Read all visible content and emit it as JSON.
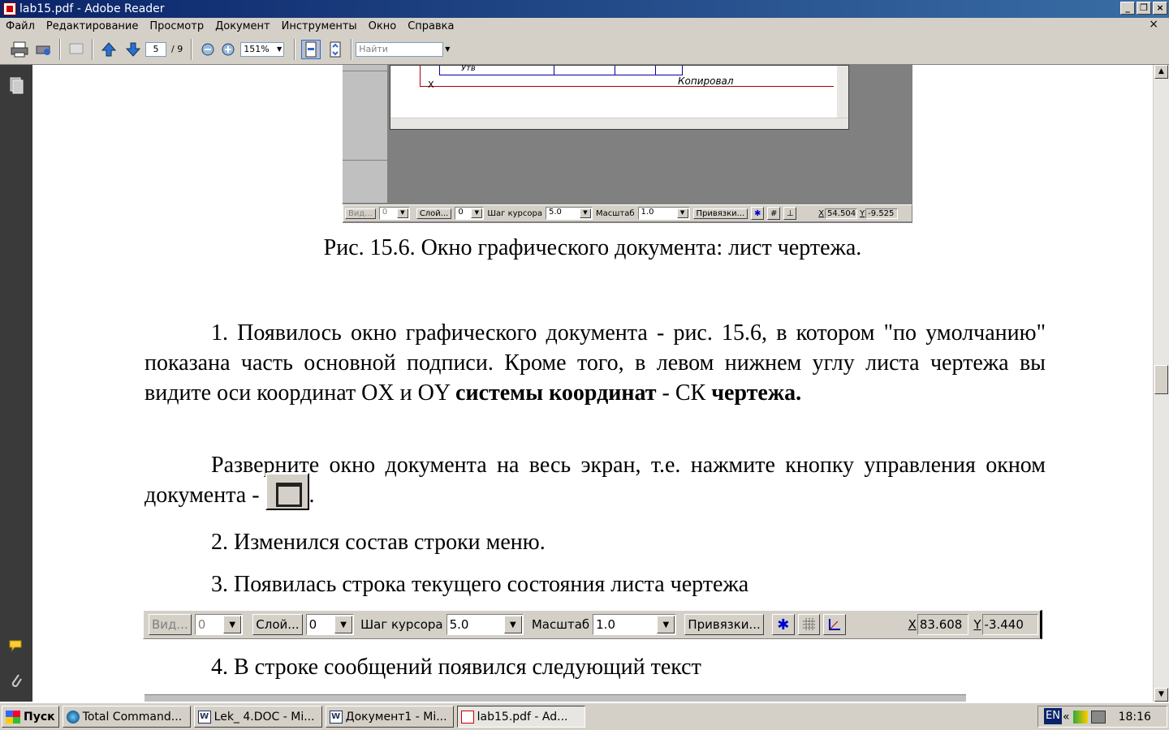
{
  "window": {
    "title": "lab15.pdf - Adobe Reader",
    "btn_min": "_",
    "btn_restore": "❐",
    "btn_close": "×",
    "doc_close": "×"
  },
  "menu": [
    "Файл",
    "Редактирование",
    "Просмотр",
    "Документ",
    "Инструменты",
    "Окно",
    "Справка"
  ],
  "toolbar": {
    "page_current": "5",
    "page_total": "/ 9",
    "zoom": "151%",
    "find_placeholder": "Найти"
  },
  "figure": {
    "stamp_text": "Копировал",
    "sheet_label": "Утв",
    "axis_x": "X",
    "status": {
      "vid": "Вид...",
      "vid_val": "0",
      "layer": "Слой...",
      "layer_val": "0",
      "step_label": "Шаг курсора",
      "step_val": "5.0",
      "scale_label": "Масштаб",
      "scale_val": "1.0",
      "snaps": "Привязки...",
      "x_label": "X",
      "x_val": "54.504",
      "y_label": "Y",
      "y_val": "-9.525"
    },
    "caption": "Рис. 15.6. Окно графического документа: лист чертежа."
  },
  "paragraphs": {
    "p1_a": "1. Появилось окно графического документа - рис. 15.6, в котором \"по умолчанию\" показана часть основной подписи. Кроме того, в левом нижнем углу листа чертежа вы видите оси координат OX и OY ",
    "p1_b1": "системы координат",
    "p1_c": " - СК ",
    "p1_b2": "чертежа.",
    "p2_a": "Разверните окно документа на весь экран, т.е. нажмите кнопку управления окном документа - ",
    "p2_end": ".",
    "p3": "2. Изменился состав строки меню.",
    "p4": "3. Появилась строка текущего состояния листа чертежа",
    "p5": "4. В строке сообщений появился следующий текст"
  },
  "statusbar2": {
    "vid": "Вид...",
    "vid_val": "0",
    "layer": "Слой...",
    "layer_val": "0",
    "step_label": "Шаг курсора",
    "step_val": "5.0",
    "scale_label": "Масштаб",
    "scale_val": "1.0",
    "snaps": "Привязки...",
    "x_label": "X",
    "x_val": "83.608",
    "y_label": "Y",
    "y_val": "-3.440"
  },
  "taskbar": {
    "start": "Пуск",
    "tasks": [
      "Total Command...",
      "Lek_ 4.DOC - Mi...",
      "Документ1 - Mi...",
      "lab15.pdf - Ad..."
    ],
    "lang": "EN",
    "tray_chevron": "«",
    "clock": "18:16"
  }
}
